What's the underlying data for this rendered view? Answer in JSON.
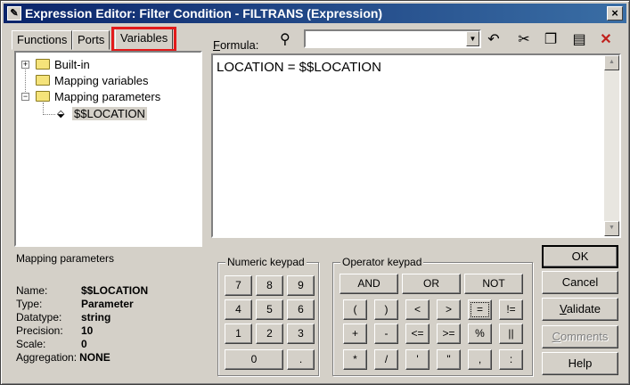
{
  "window": {
    "title": "Expression Editor: Filter Condition - FILTRANS (Expression)",
    "close_glyph": "×"
  },
  "tabs": [
    {
      "label": "Functions"
    },
    {
      "label": "Ports"
    },
    {
      "label": "Variables",
      "active": true
    }
  ],
  "tree": {
    "items": [
      {
        "label": "Built-in",
        "expander": "+"
      },
      {
        "label": "Mapping variables"
      },
      {
        "label": "Mapping parameters",
        "expander": "−"
      },
      {
        "label": "$$LOCATION",
        "selected": true
      }
    ]
  },
  "details": {
    "heading": "Mapping parameters",
    "props": [
      {
        "key": "Name:",
        "value": "$$LOCATION"
      },
      {
        "key": "Type:",
        "value": "Parameter"
      },
      {
        "key": "Datatype:",
        "value": "string"
      },
      {
        "key": "Precision:",
        "value": "10"
      },
      {
        "key": "Scale:",
        "value": "0"
      },
      {
        "key": "Aggregation:",
        "value": "NONE"
      }
    ]
  },
  "formula": {
    "label_prefix": "F",
    "label_rest": "ormula:",
    "text": "LOCATION = $$LOCATION",
    "search_value": ""
  },
  "toolbar": {
    "icons": [
      "binoculars-icon",
      "undo-icon",
      "cut-icon",
      "copy-icon",
      "paste-icon",
      "delete-icon"
    ],
    "delete_color": "#c0201c"
  },
  "numeric_keypad": {
    "title": "Numeric keypad",
    "keys": [
      "7",
      "8",
      "9",
      "4",
      "5",
      "6",
      "1",
      "2",
      "3",
      "0",
      "."
    ]
  },
  "operator_keypad": {
    "title": "Operator keypad",
    "keys": [
      "AND",
      "OR",
      "NOT",
      "(",
      ")",
      "<",
      ">",
      "=",
      "!=",
      "+",
      "-",
      "<=",
      ">=",
      "%",
      "||",
      "*",
      "/",
      "'",
      "\"",
      ",",
      ":"
    ]
  },
  "buttons": {
    "ok": "OK",
    "cancel": "Cancel",
    "validate_prefix": "V",
    "validate_rest": "alidate",
    "comments_prefix": "C",
    "comments_rest": "omments",
    "help": "Help"
  },
  "colors": {
    "title_bar": "#0a246a",
    "highlight": "#e21b1b",
    "face": "#d4d0c8"
  }
}
